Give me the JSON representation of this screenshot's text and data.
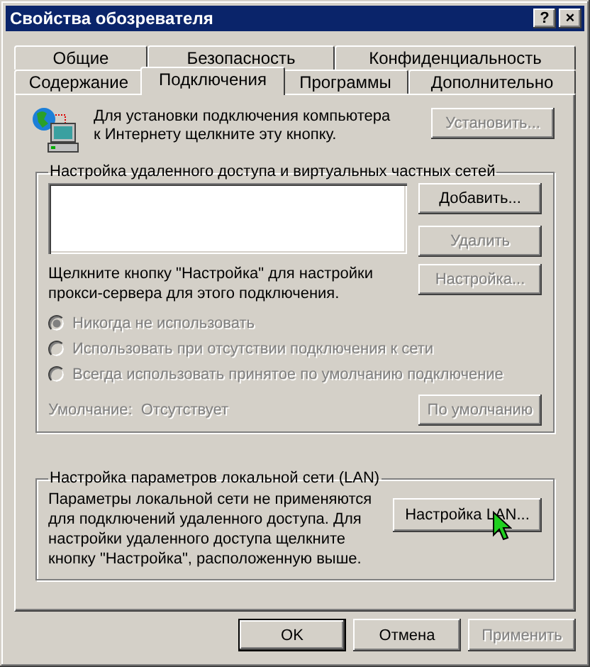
{
  "window": {
    "title": "Свойства обозревателя",
    "title_buttons": [
      "?",
      "×"
    ]
  },
  "tab_rows": [
    [
      {
        "label": "Общие",
        "selected": false
      },
      {
        "label": "Безопасность",
        "selected": false
      },
      {
        "label": "Конфиденциальность",
        "selected": false
      }
    ],
    [
      {
        "label": "Содержание",
        "selected": false
      },
      {
        "label": "Подключения",
        "selected": true
      },
      {
        "label": "Программы",
        "selected": false
      },
      {
        "label": "Дополнительно",
        "selected": false
      }
    ]
  ],
  "setup": {
    "text": "Для установки подключения компьютера к Интернету щелкните эту кнопку.",
    "button": {
      "label": "Установить...",
      "disabled": true
    }
  },
  "dialup": {
    "title": "Настройка удаленного доступа и виртуальных частных сетей",
    "buttons": [
      {
        "label": "Добавить...",
        "disabled": false
      },
      {
        "label": "Удалить",
        "disabled": true
      }
    ],
    "proxy_text": "Щелкните кнопку \"Настройка\" для настройки прокси-сервера для этого подключения.",
    "settings_button": {
      "label": "Настройка...",
      "disabled": true
    },
    "radios": [
      {
        "label": "Никогда не использовать",
        "selected": true,
        "disabled": true
      },
      {
        "label": "Использовать при отсутствии подключения к сети",
        "selected": false,
        "disabled": true
      },
      {
        "label": "Всегда использовать принятое по умолчанию подключение",
        "selected": false,
        "disabled": true
      }
    ],
    "default_label": "Умолчание:",
    "default_value": "Отсутствует",
    "default_disabled": true,
    "default_button": {
      "label": "По умолчанию",
      "disabled": true
    }
  },
  "lan": {
    "title": "Настройка параметров локальной сети (LAN)",
    "text": "Параметры локальной сети не применяются для подключений удаленного доступа. Для настройки удаленного доступа щелкните кнопку \"Настройка\", расположенную выше.",
    "button": {
      "label": "Настройка LAN...",
      "disabled": false
    }
  },
  "buttons": [
    {
      "label": "OK",
      "default": true,
      "disabled": false
    },
    {
      "label": "Отмена",
      "default": false,
      "disabled": false
    },
    {
      "label": "Применить",
      "default": false,
      "disabled": true
    }
  ]
}
